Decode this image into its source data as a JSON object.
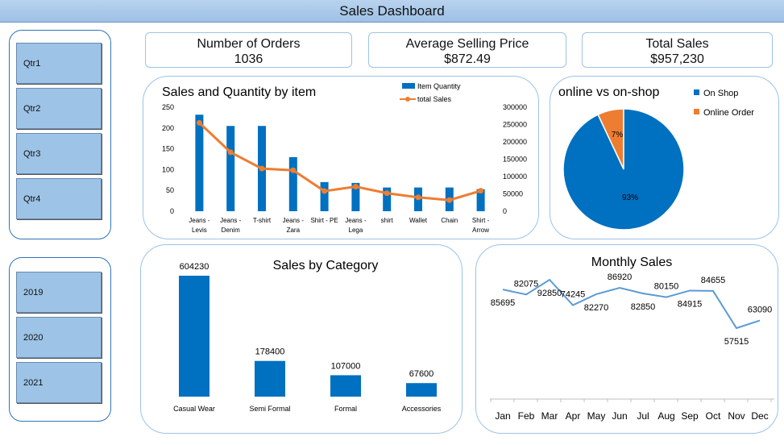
{
  "dashboard_title": "Sales Dashboard",
  "slicers": {
    "quarters": [
      "Qtr1",
      "Qtr2",
      "Qtr3",
      "Qtr4"
    ],
    "years": [
      "2019",
      "2020",
      "2021"
    ]
  },
  "kpis": [
    {
      "label": "Number of Orders",
      "value": "1036"
    },
    {
      "label": "Average Selling Price",
      "value": "$872.49"
    },
    {
      "label": "Total Sales",
      "value": "$957,230"
    }
  ],
  "chart_data": [
    {
      "type": "bar",
      "title": "Sales and Quantity by item",
      "categories": [
        [
          "Jeans -",
          "Levis"
        ],
        [
          "Jeans -",
          "Denim"
        ],
        [
          "T-shirt"
        ],
        [
          "Jeans -",
          "Zara"
        ],
        [
          "Shirt - PE"
        ],
        [
          "Jeans -",
          "Lega"
        ],
        [
          "shirt"
        ],
        [
          "Wallet"
        ],
        [
          "Chain"
        ],
        [
          "Shirt -",
          "Arrow"
        ]
      ],
      "series": [
        {
          "name": "Item Quantity",
          "axis": "left",
          "type": "bar",
          "color": "#0070c0",
          "values": [
            232,
            205,
            205,
            130,
            70,
            68,
            57,
            57,
            57,
            53
          ]
        },
        {
          "name": "total Sales",
          "axis": "right",
          "type": "line",
          "color": "#ed7d31",
          "values": [
            255000,
            170000,
            123000,
            118000,
            58000,
            71000,
            52000,
            40000,
            32000,
            59000
          ]
        }
      ],
      "y_left": {
        "ticks": [
          0,
          50,
          100,
          150,
          200,
          250
        ],
        "range": [
          0,
          250
        ]
      },
      "y_right": {
        "ticks": [
          0,
          50000,
          100000,
          150000,
          200000,
          250000,
          300000
        ],
        "range": [
          0,
          300000
        ]
      },
      "legend_position": "top"
    },
    {
      "type": "pie",
      "title": "online vs on-shop",
      "slices": [
        {
          "label": "On Shop",
          "value": 93,
          "display": "93%",
          "color": "#0070c0"
        },
        {
          "label": "Online Order",
          "value": 7,
          "display": "7%",
          "color": "#ed7d31"
        }
      ],
      "legend_position": "right"
    },
    {
      "type": "bar",
      "title": "Sales by Category",
      "categories": [
        "Casual Wear",
        "Semi Formal",
        "Formal",
        "Accessories"
      ],
      "values": [
        604230,
        178400,
        107000,
        67600
      ],
      "color": "#0070c0"
    },
    {
      "type": "line",
      "title": "Monthly Sales",
      "categories": [
        "Jan",
        "Feb",
        "Mar",
        "Apr",
        "May",
        "Jun",
        "Jul",
        "Aug",
        "Sep",
        "Oct",
        "Nov",
        "Dec"
      ],
      "values": [
        85695,
        82075,
        92850,
        74245,
        82270,
        86920,
        82850,
        80150,
        84915,
        84655,
        57515,
        63090
      ],
      "color": "#5b9bd5"
    }
  ]
}
